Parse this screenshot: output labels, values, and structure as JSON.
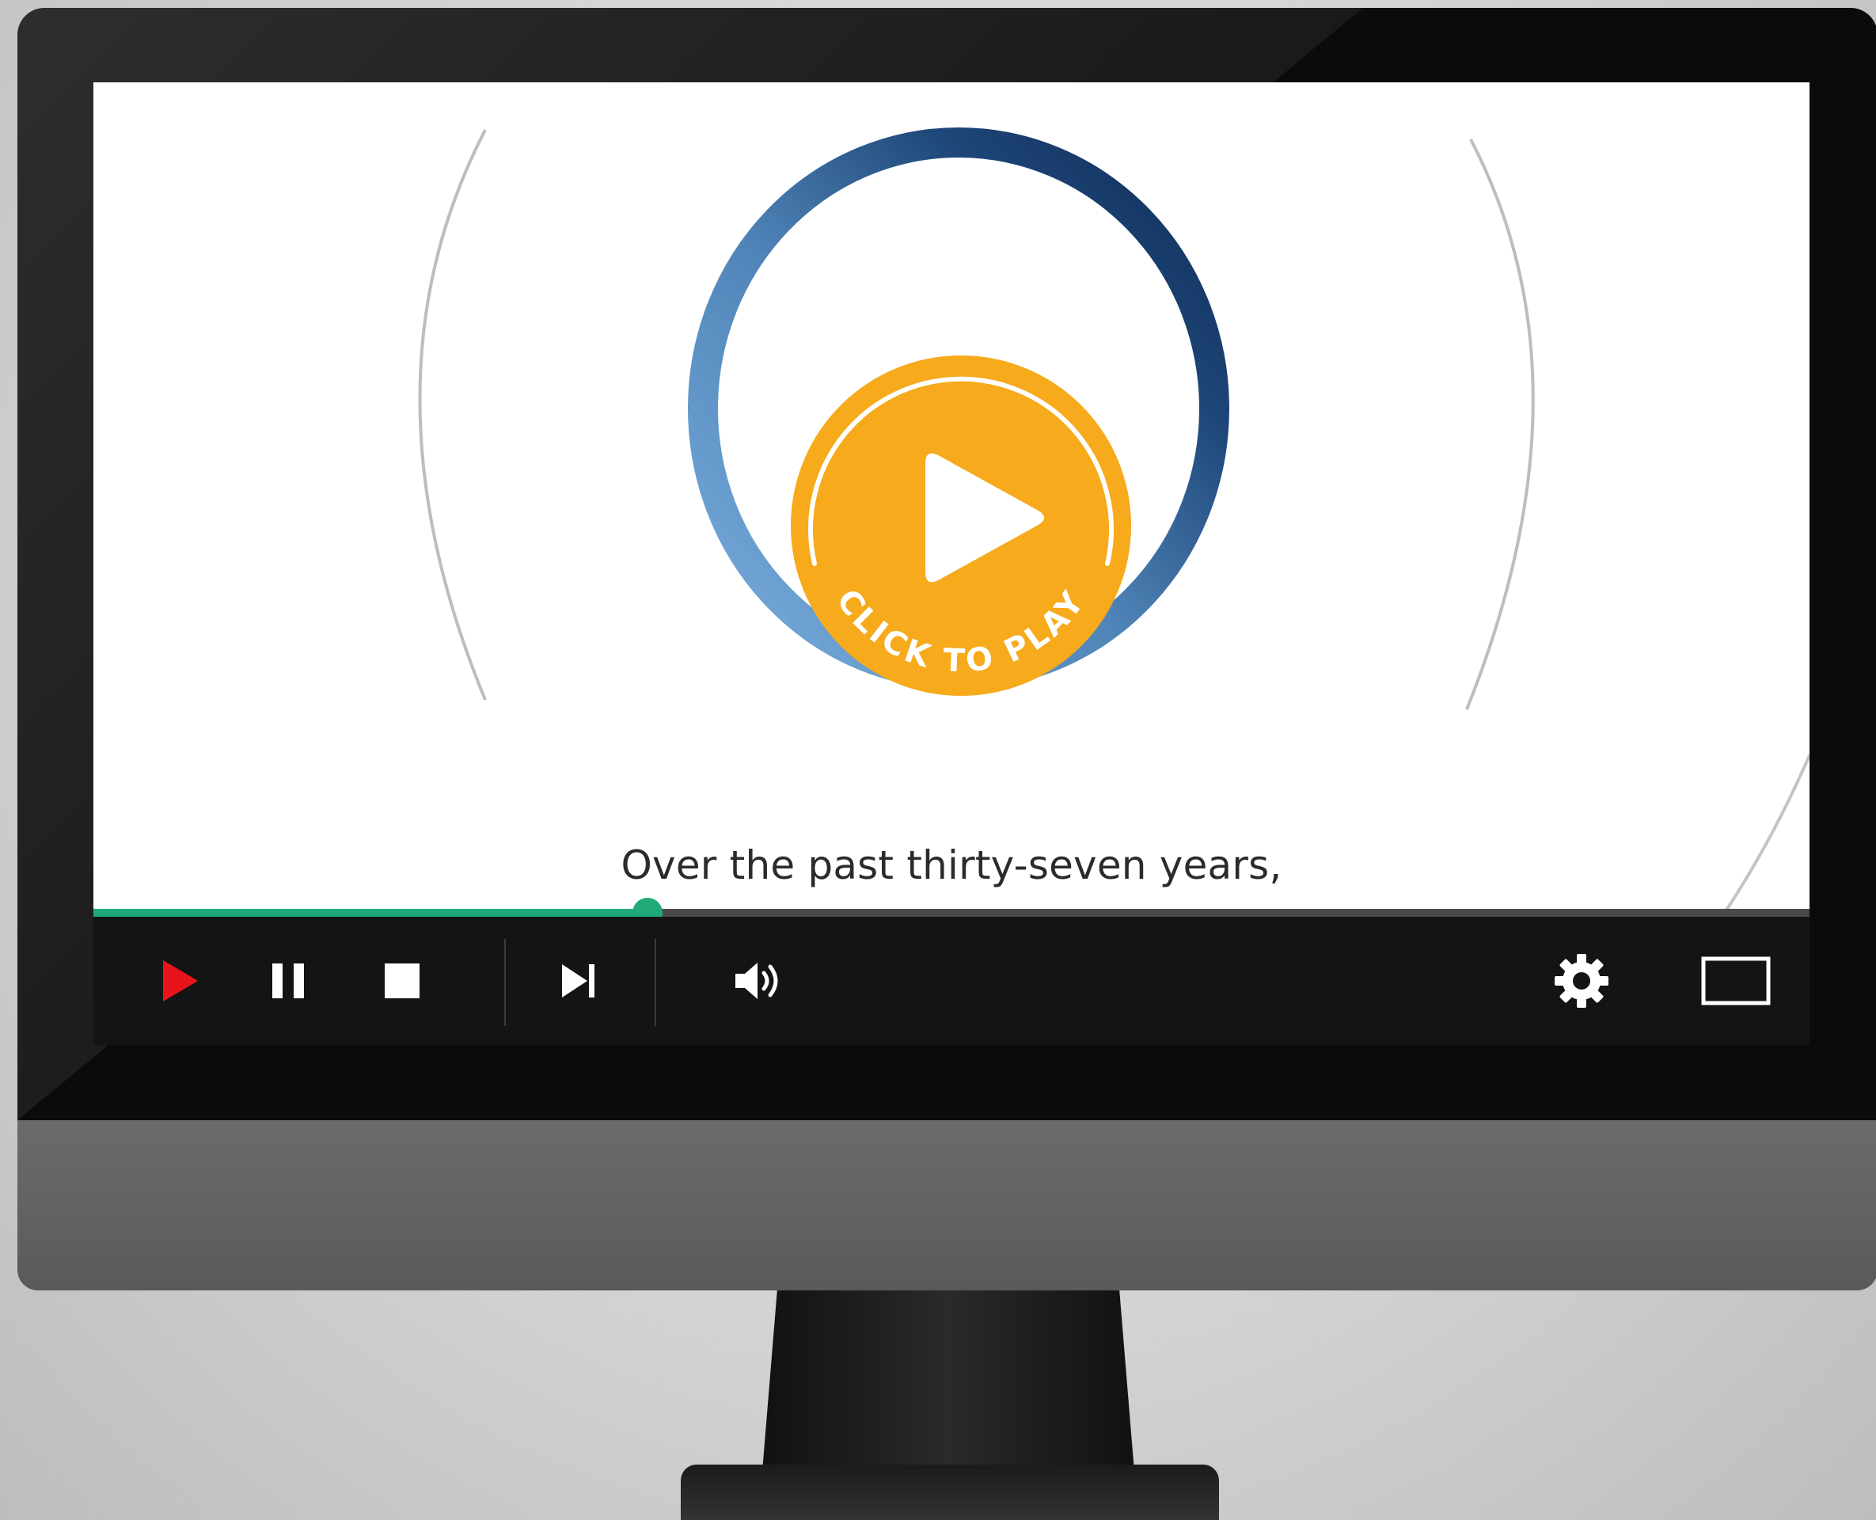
{
  "player": {
    "caption": "Over the past thirty-seven years,",
    "overlay_label": "CLICK TO PLAY",
    "progress_fraction": 0.323,
    "controls": [
      "play-icon",
      "pause-icon",
      "stop-icon",
      "skip-next-icon",
      "volume-icon",
      "settings-gear-icon",
      "theater-mode-icon"
    ]
  },
  "colors": {
    "overlay_fill": "#F6AA1C",
    "progress": "#1FAA78",
    "play_icon": "#E8141A",
    "controls_bg": "#141414",
    "ring_light": "#5E95C4",
    "ring_dark": "#13325C"
  }
}
